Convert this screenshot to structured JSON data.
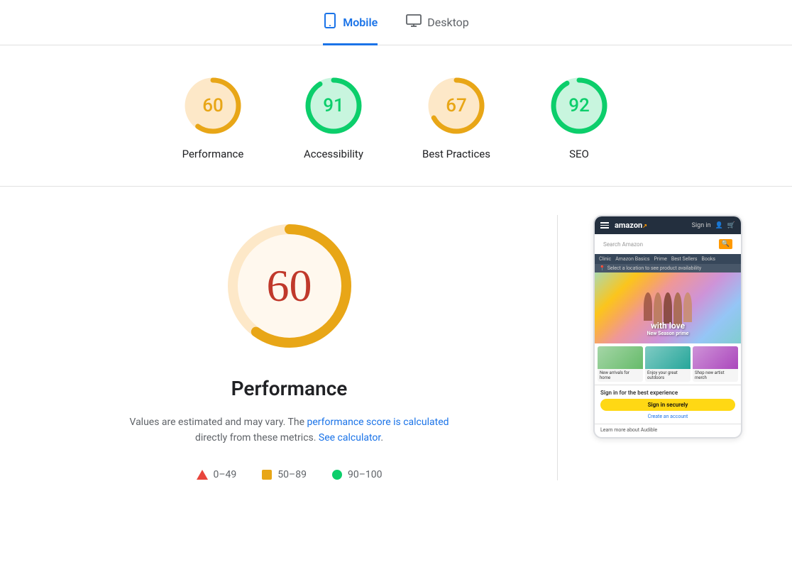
{
  "tabs": [
    {
      "id": "mobile",
      "label": "Mobile",
      "active": true,
      "icon": "📱"
    },
    {
      "id": "desktop",
      "label": "Desktop",
      "active": false,
      "icon": "🖥"
    }
  ],
  "scores": [
    {
      "id": "performance",
      "value": 60,
      "label": "Performance",
      "color": "#e8a617",
      "trackColor": "#fde8c8",
      "threshold": "medium"
    },
    {
      "id": "accessibility",
      "value": 91,
      "label": "Accessibility",
      "color": "#0cce6b",
      "trackColor": "#c8f5de",
      "threshold": "good"
    },
    {
      "id": "best-practices",
      "value": 67,
      "label": "Best Practices",
      "color": "#e8a617",
      "trackColor": "#fde8c8",
      "threshold": "medium"
    },
    {
      "id": "seo",
      "value": 92,
      "label": "SEO",
      "color": "#0cce6b",
      "trackColor": "#c8f5de",
      "threshold": "good"
    }
  ],
  "bigScore": {
    "value": "60",
    "label": "Performance",
    "color": "#c0392b",
    "arcColor": "#e8a617",
    "trackColor": "#fde8c8"
  },
  "description": {
    "prefix": "Values are estimated and may vary. The ",
    "link1Text": "performance score is calculated",
    "link1Url": "#",
    "middle": " directly from these metrics. ",
    "link2Text": "See calculator",
    "link2Url": "#",
    "suffix": "."
  },
  "legend": [
    {
      "id": "poor",
      "shape": "triangle",
      "color": "#e8453c",
      "range": "0–49"
    },
    {
      "id": "medium",
      "shape": "square",
      "color": "#e8a617",
      "range": "50–89"
    },
    {
      "id": "good",
      "shape": "circle",
      "color": "#0cce6b",
      "range": "90–100"
    }
  ],
  "phone": {
    "navLinks": [
      "Clinic",
      "Amazon Basics",
      "Prime",
      "Best Sellers",
      "Books"
    ],
    "locationText": "Select a location to see product availability",
    "heroText": "with love",
    "heroSub": "New Season prime",
    "products": [
      {
        "label": "New arrivals for home"
      },
      {
        "label": "Enjoy your great outdoors"
      },
      {
        "label": "Shop new artist merch"
      }
    ],
    "signInTitle": "Sign in for the best experience",
    "signInBtn": "Sign in securely",
    "createAccount": "Create an account",
    "audible": "Learn more about Audible"
  }
}
